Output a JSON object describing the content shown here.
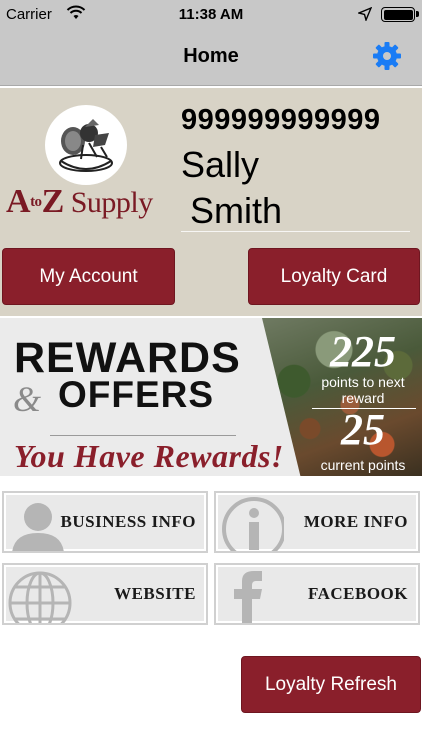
{
  "status_bar": {
    "carrier": "Carrier",
    "time": "11:38 AM"
  },
  "nav": {
    "title": "Home",
    "settings_icon": "gear-icon",
    "accent_color": "#1a7cf5"
  },
  "profile": {
    "logo": {
      "text_a": "A",
      "text_to": "to",
      "text_z": "Z",
      "text_supply": "Supply"
    },
    "member_id": "999999999999",
    "first_name": "Sally",
    "last_name": "Smith",
    "my_account_label": "My Account",
    "loyalty_card_label": "Loyalty Card"
  },
  "rewards": {
    "title_line1": "REWARDS",
    "title_amp": "&",
    "title_line2": "OFFERS",
    "status": "You Have Rewards!",
    "points_to_next": "225",
    "points_to_next_label": "points to next reward",
    "current_points": "25",
    "current_points_label": "current points"
  },
  "tiles": [
    {
      "label": "BUSINESS INFO",
      "icon": "person-icon"
    },
    {
      "label": "MORE INFO",
      "icon": "info-icon"
    },
    {
      "label": "WEBSITE",
      "icon": "globe-icon"
    },
    {
      "label": "FACEBOOK",
      "icon": "facebook-icon"
    }
  ],
  "footer": {
    "refresh_label": "Loyalty Refresh"
  },
  "colors": {
    "brand": "#8a1f2b",
    "header_bg": "#c8c8c8",
    "profile_bg": "#d8d3c6"
  }
}
